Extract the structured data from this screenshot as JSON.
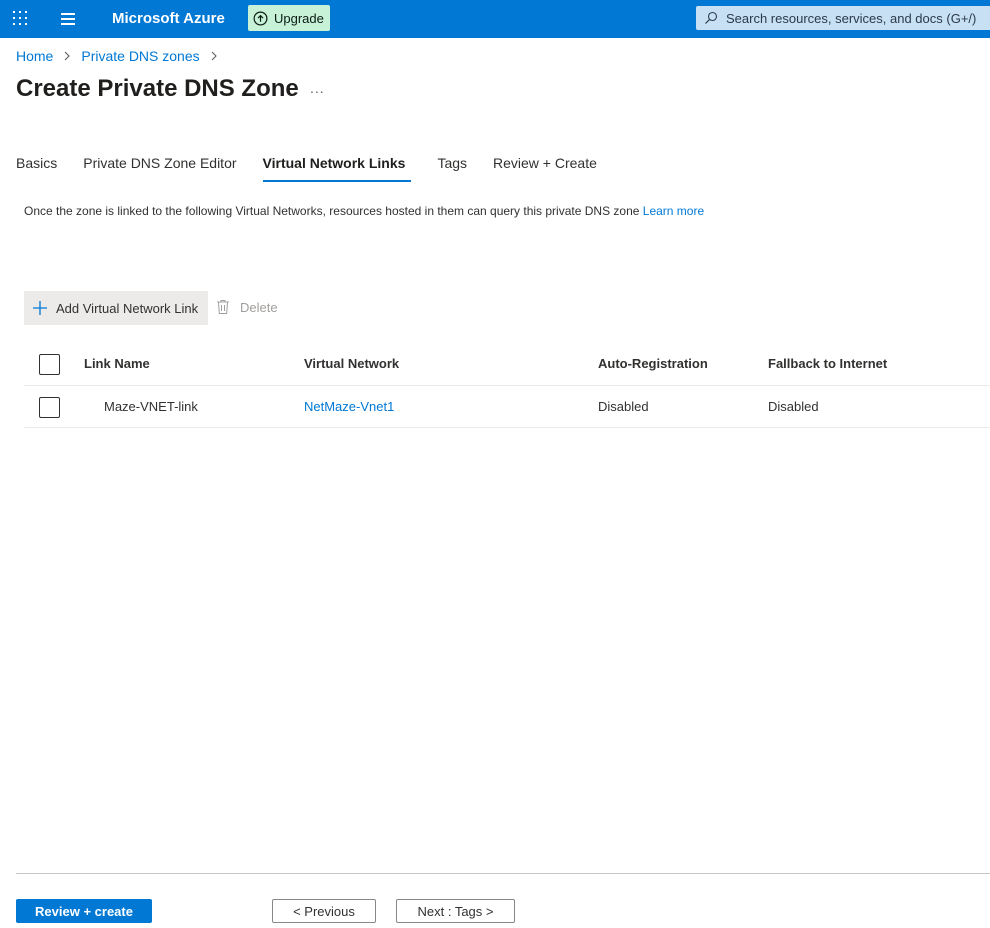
{
  "header": {
    "brand": "Microsoft Azure",
    "upgrade_label": "Upgrade",
    "search_placeholder": "Search resources, services, and docs (G+/)"
  },
  "breadcrumb": {
    "items": [
      "Home",
      "Private DNS zones"
    ]
  },
  "page": {
    "title": "Create Private DNS Zone",
    "more": "..."
  },
  "tabs": [
    {
      "label": "Basics",
      "active": false
    },
    {
      "label": "Private DNS Zone Editor",
      "active": false
    },
    {
      "label": "Virtual Network Links",
      "active": true
    },
    {
      "label": "Tags",
      "active": false
    },
    {
      "label": "Review + Create",
      "active": false
    }
  ],
  "intro": {
    "text": "Once the zone is linked to the following Virtual Networks, resources hosted in them can query this private DNS zone ",
    "link": "Learn more"
  },
  "commands": {
    "add_label": "Add Virtual Network Link",
    "delete_label": "Delete"
  },
  "table": {
    "columns": [
      "Link Name",
      "Virtual Network",
      "Auto-Registration",
      "Fallback to Internet"
    ],
    "rows": [
      {
        "link_name": "Maze-VNET-link",
        "virtual_network": "NetMaze-Vnet1",
        "auto_registration": "Disabled",
        "fallback": "Disabled"
      }
    ]
  },
  "footer": {
    "review_create": "Review + create",
    "previous": "< Previous",
    "next": "Next : Tags >"
  },
  "colors": {
    "accent": "#0078d4",
    "upgrade_bg": "#c7f2d8",
    "search_bg": "#c7e0f4"
  }
}
